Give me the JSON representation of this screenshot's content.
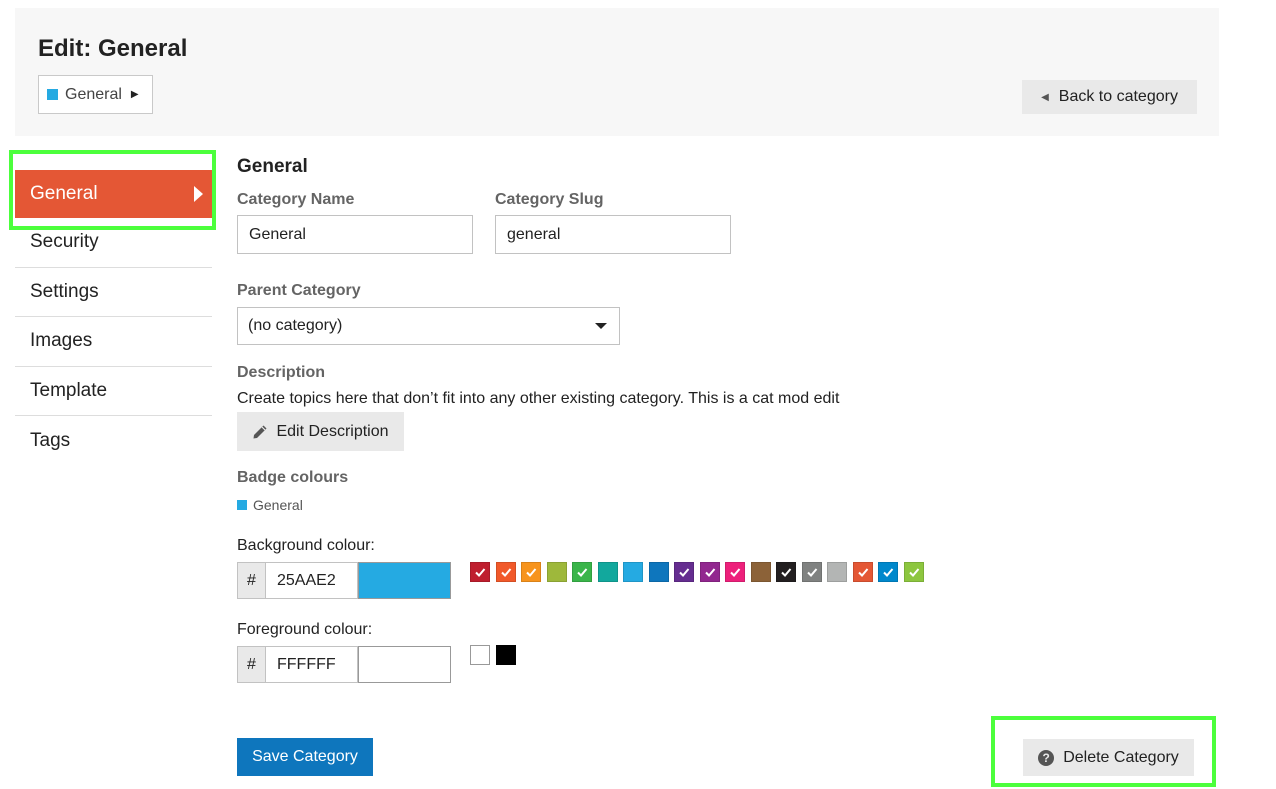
{
  "header": {
    "title": "Edit: General",
    "breadcrumb": {
      "label": "General",
      "color": "#25AAE2"
    },
    "back_label": "Back to category"
  },
  "sidebar": {
    "items": [
      {
        "label": "General",
        "active": true
      },
      {
        "label": "Security"
      },
      {
        "label": "Settings"
      },
      {
        "label": "Images"
      },
      {
        "label": "Template"
      },
      {
        "label": "Tags"
      }
    ]
  },
  "form": {
    "section_title": "General",
    "name_label": "Category Name",
    "name_value": "General",
    "slug_label": "Category Slug",
    "slug_value": "general",
    "parent_label": "Parent Category",
    "parent_value": "(no category)",
    "description_label": "Description",
    "description_text": "Create topics here that don’t fit into any other existing category. This is a cat mod edit",
    "edit_description_label": "Edit Description",
    "badge_label": "Badge colours",
    "badge_preview": "General",
    "bg_label": "Background colour:",
    "bg_prefix": "#",
    "bg_value": "25AAE2",
    "bg_color": "#25AAE2",
    "bg_swatches": [
      {
        "color": "#BF1E2E",
        "checked": true
      },
      {
        "color": "#F1592A",
        "checked": true
      },
      {
        "color": "#F7941D",
        "checked": true
      },
      {
        "color": "#9EB83B",
        "checked": false
      },
      {
        "color": "#3AB54A",
        "checked": true
      },
      {
        "color": "#12A89D",
        "checked": false
      },
      {
        "color": "#25AAE2",
        "checked": false
      },
      {
        "color": "#0E76BD",
        "checked": false
      },
      {
        "color": "#652D90",
        "checked": true
      },
      {
        "color": "#92278F",
        "checked": true
      },
      {
        "color": "#ED207B",
        "checked": true
      },
      {
        "color": "#8C6238",
        "checked": false
      },
      {
        "color": "#231F20",
        "checked": true
      },
      {
        "color": "#808281",
        "checked": true
      },
      {
        "color": "#B3B5B4",
        "checked": false
      },
      {
        "color": "#E45735",
        "checked": true
      },
      {
        "color": "#0088CC",
        "checked": true
      },
      {
        "color": "#8DC63F",
        "checked": true
      }
    ],
    "fg_label": "Foreground colour:",
    "fg_prefix": "#",
    "fg_value": "FFFFFF",
    "fg_color": "#FFFFFF",
    "fg_swatches": [
      {
        "color": "#FFFFFF",
        "checked": false
      },
      {
        "color": "#000000",
        "checked": false
      }
    ],
    "save_label": "Save Category",
    "delete_label": "Delete Category"
  }
}
